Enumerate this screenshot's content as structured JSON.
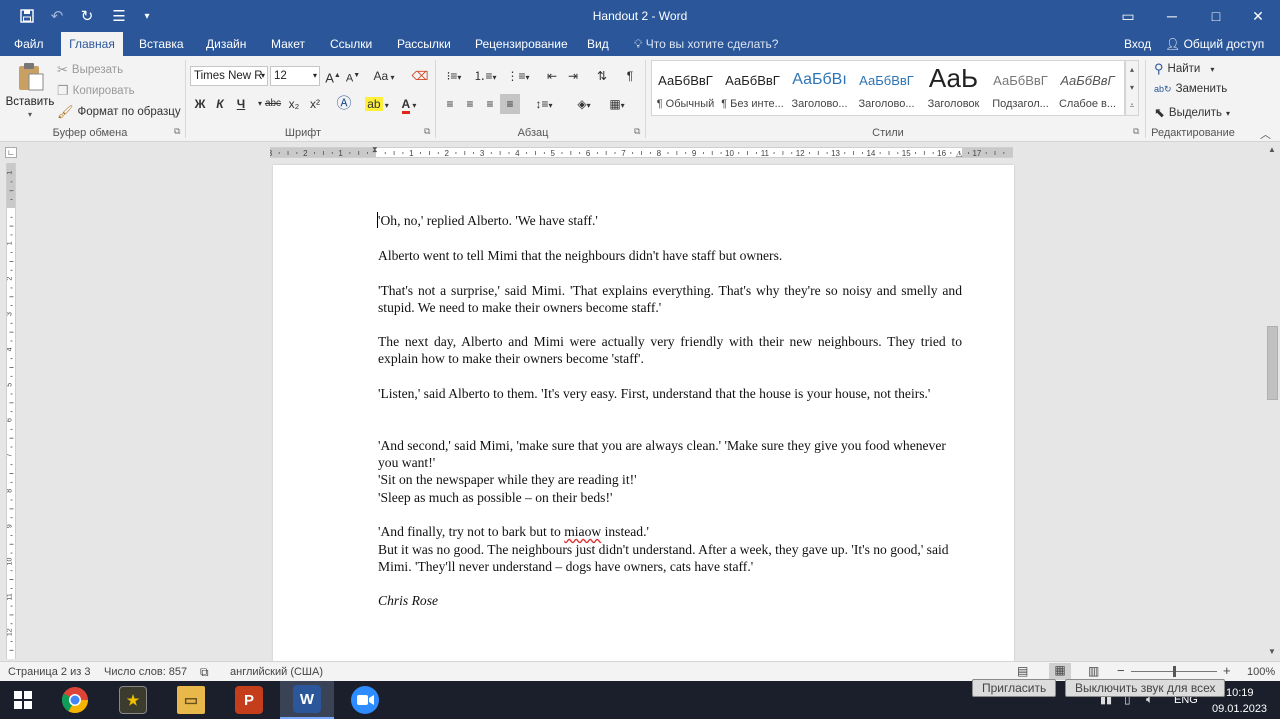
{
  "titlebar": {
    "title": "Handout 2 - Word",
    "icons": [
      "save-icon",
      "undo-icon",
      "redo-icon",
      "list-icon",
      "customize-icon"
    ],
    "window": {
      "restore_glyph": "▭",
      "minimize_glyph": "─",
      "maximize_glyph": "□",
      "close_glyph": "✕"
    }
  },
  "menu": {
    "tabs": [
      "Файл",
      "Главная",
      "Вставка",
      "Дизайн",
      "Макет",
      "Ссылки",
      "Рассылки",
      "Рецензирование",
      "Вид"
    ],
    "active_tab": "Главная",
    "tell_me": "Что вы хотите сделать?",
    "signin": "Вход",
    "share": "Общий доступ"
  },
  "ribbon": {
    "clipboard": {
      "paste": "Вставить",
      "cut": "Вырезать",
      "copy": "Копировать",
      "format_painter": "Формат по образцу",
      "label": "Буфер обмена"
    },
    "font": {
      "name": "Times New R",
      "size": "12",
      "label": "Шрифт",
      "bold": "Ж",
      "italic": "К",
      "underline": "Ч",
      "strike": "abc",
      "subscript": "x₂",
      "superscript": "x²",
      "grow": "A",
      "shrink": "A",
      "case": "Aa",
      "color_glyph": "A"
    },
    "paragraph": {
      "label": "Абзац"
    },
    "styles": {
      "label": "Стили",
      "items": [
        {
          "sample": "АаБбВвГ",
          "name": "¶ Обычный"
        },
        {
          "sample": "АаБбВвГ",
          "name": "¶ Без инте..."
        },
        {
          "sample": "АаБбВı",
          "name": "Заголово..."
        },
        {
          "sample": "АаБбВвГ",
          "name": "Заголово..."
        },
        {
          "sample": "АаЬ",
          "name": "Заголовок"
        },
        {
          "sample": "АаБбВвГ",
          "name": "Подзагол..."
        },
        {
          "sample": "АаБбВвГ",
          "name": "Слабое в..."
        }
      ]
    },
    "editing": {
      "label": "Редактирование",
      "find": "Найти",
      "replace": "Заменить",
      "select": "Выделить"
    }
  },
  "document": {
    "paragraphs": [
      "'Oh, no,' replied Alberto. 'We have staff.'",
      "Alberto went to tell Mimi that the neighbours didn't have staff but owners.",
      "'That's not a surprise,' said Mimi. 'That explains everything. That's why they're so noisy and smelly and stupid. We need to make their owners become staff.'",
      "The next day, Alberto and Mimi were actually very friendly with their new neighbours. They tried to explain how to make their owners become 'staff'.",
      "'Listen,' said Alberto to them. 'It's very easy. First, understand that the house is your house, not theirs.'",
      "'And second,' said Mimi, 'make sure that you are always clean.' 'Make sure they give you food whenever you want!'",
      "'Sit on the newspaper while they are reading it!'",
      "'Sleep as much as possible – on their beds!'",
      "'And finally, try not to bark but to miaow instead.'",
      "But it was no good. The neighbours just didn't understand. After a week, they gave up. 'It's no good,' said Mimi. 'They'll never understand – dogs have owners, cats have staff.'",
      "Chris Rose"
    ],
    "last_para_prefix": "'And finally, try not to bark but to ",
    "misspelled": "miaow",
    "last_para_suffix": " instead.'"
  },
  "ruler": {
    "h_labels": [
      "3",
      "2",
      "1",
      "1",
      "2",
      "3",
      "4",
      "5",
      "6",
      "7",
      "8",
      "9",
      "10",
      "11",
      "12",
      "13",
      "14",
      "15",
      "16",
      "17"
    ],
    "v_labels": [
      "1",
      "1",
      "2",
      "3",
      "4",
      "5",
      "6",
      "7",
      "8",
      "9",
      "10",
      "11",
      "12"
    ]
  },
  "status": {
    "page": "Страница 2 из 3",
    "words": "Число слов: 857",
    "language": "английский (США)",
    "zoom": "100%",
    "zoom_level": 1.0
  },
  "taskbar": {
    "apps": [
      "windows-start",
      "chrome",
      "media-app",
      "file-explorer",
      "powerpoint",
      "word",
      "zoom"
    ],
    "active_app": "word",
    "invite": "Пригласить",
    "mute": "Выключить звук для всех",
    "lang": "ENG",
    "time": "10:19",
    "date": "09.01.2023"
  },
  "colors": {
    "word_blue": "#2b579a",
    "ribbon_bg": "#f3f3f3",
    "doc_bg": "#e6e6e6",
    "taskbar_bg": "#1a1f2b"
  }
}
